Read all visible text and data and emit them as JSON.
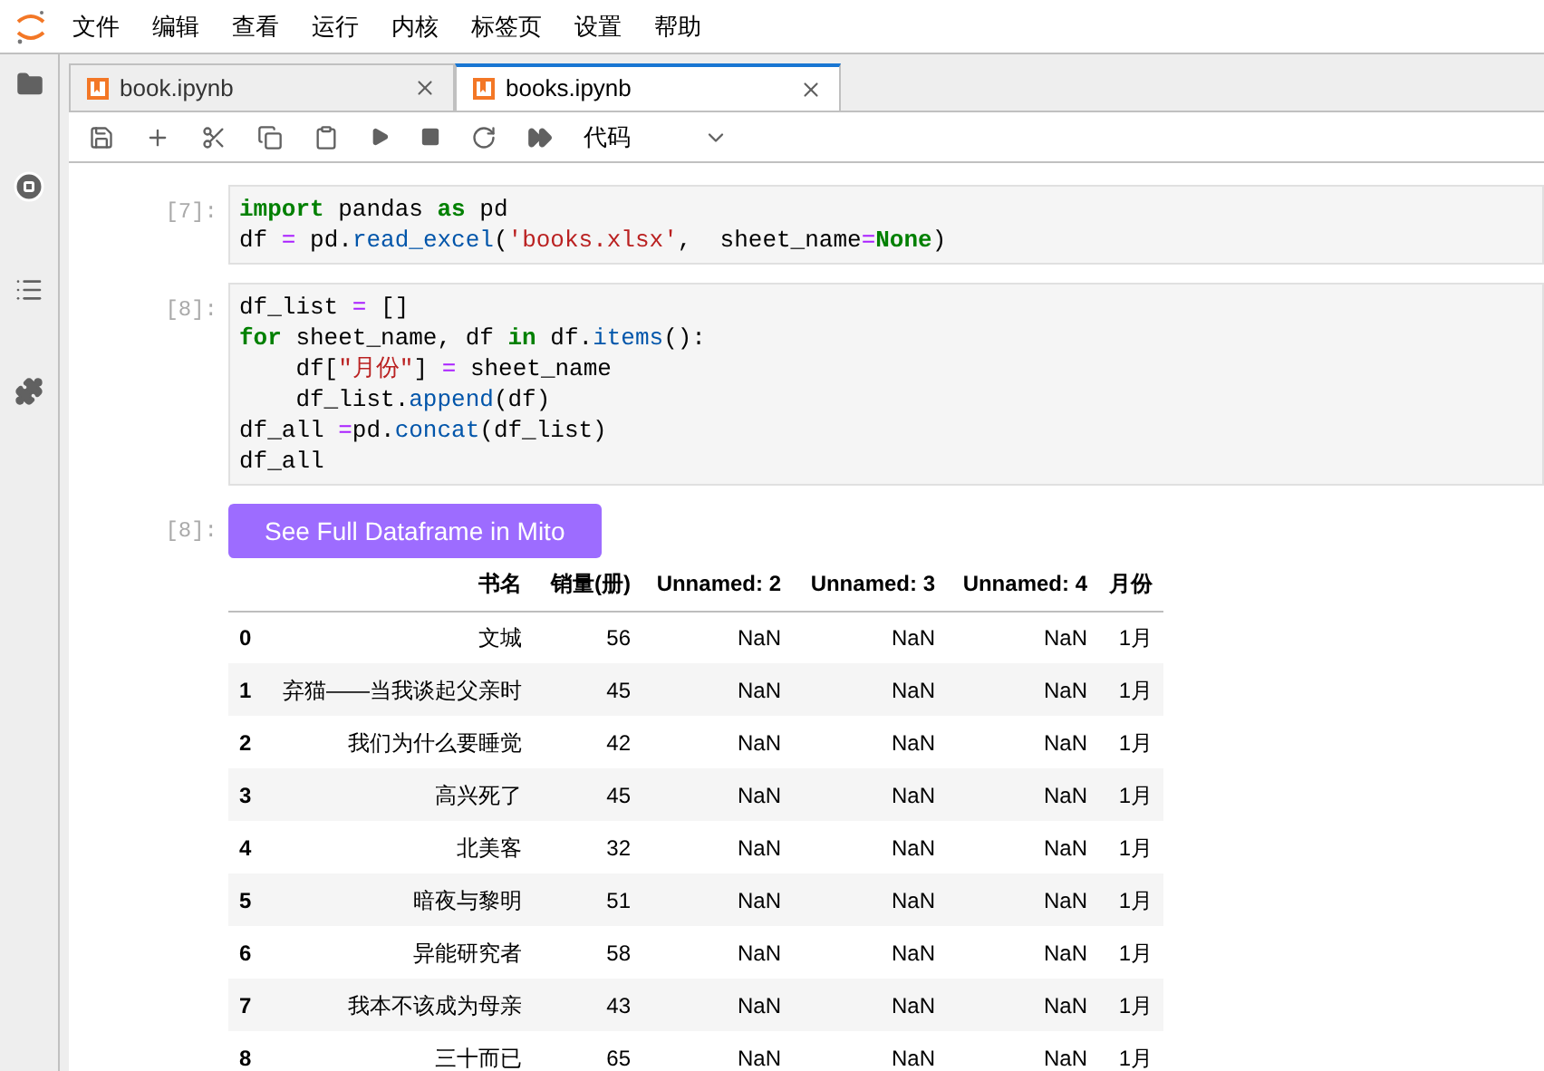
{
  "menu": [
    "文件",
    "编辑",
    "查看",
    "运行",
    "内核",
    "标签页",
    "设置",
    "帮助"
  ],
  "tabs": [
    {
      "label": "book.ipynb",
      "selected": false
    },
    {
      "label": "books.ipynb",
      "selected": true
    }
  ],
  "toolbar": {
    "cell_type": "代码"
  },
  "cells": [
    {
      "prompt": "[7]:",
      "lines": [
        [
          {
            "text": "import",
            "kind": "kw"
          },
          {
            "text": " pandas ",
            "kind": "plain"
          },
          {
            "text": "as",
            "kind": "kw"
          },
          {
            "text": " pd",
            "kind": "plain"
          }
        ],
        [
          {
            "text": "df ",
            "kind": "plain"
          },
          {
            "text": "=",
            "kind": "op"
          },
          {
            "text": " pd.",
            "kind": "plain"
          },
          {
            "text": "read_excel",
            "kind": "fn"
          },
          {
            "text": "(",
            "kind": "plain"
          },
          {
            "text": "'books.xlsx'",
            "kind": "str"
          },
          {
            "text": ",  sheet_name",
            "kind": "plain"
          },
          {
            "text": "=",
            "kind": "op"
          },
          {
            "text": "None",
            "kind": "kw"
          },
          {
            "text": ")",
            "kind": "plain"
          }
        ]
      ]
    },
    {
      "prompt": "[8]:",
      "lines": [
        [
          {
            "text": "df_list ",
            "kind": "plain"
          },
          {
            "text": "=",
            "kind": "op"
          },
          {
            "text": " []",
            "kind": "plain"
          }
        ],
        [
          {
            "text": "for",
            "kind": "kw"
          },
          {
            "text": " sheet_name, df ",
            "kind": "plain"
          },
          {
            "text": "in",
            "kind": "kw"
          },
          {
            "text": " df.",
            "kind": "plain"
          },
          {
            "text": "items",
            "kind": "fn"
          },
          {
            "text": "():",
            "kind": "plain"
          }
        ],
        [
          {
            "text": "    df[",
            "kind": "plain"
          },
          {
            "text": "\"月份\"",
            "kind": "str"
          },
          {
            "text": "] ",
            "kind": "plain"
          },
          {
            "text": "=",
            "kind": "op"
          },
          {
            "text": " sheet_name",
            "kind": "plain"
          }
        ],
        [
          {
            "text": "    df_list.",
            "kind": "plain"
          },
          {
            "text": "append",
            "kind": "fn"
          },
          {
            "text": "(df)",
            "kind": "plain"
          }
        ],
        [
          {
            "text": "df_all ",
            "kind": "plain"
          },
          {
            "text": "=",
            "kind": "op"
          },
          {
            "text": "pd.",
            "kind": "plain"
          },
          {
            "text": "concat",
            "kind": "fn"
          },
          {
            "text": "(df_list)",
            "kind": "plain"
          }
        ],
        [
          {
            "text": "df_all",
            "kind": "plain"
          }
        ]
      ]
    }
  ],
  "output": {
    "prompt": "[8]:",
    "button": "See Full Dataframe in Mito",
    "table": {
      "columns": [
        "书名",
        "销量(册)",
        "Unnamed: 2",
        "Unnamed: 3",
        "Unnamed: 4",
        "月份"
      ],
      "rows": [
        {
          "index": "0",
          "cells": [
            "文城",
            "56",
            "NaN",
            "NaN",
            "NaN",
            "1月"
          ]
        },
        {
          "index": "1",
          "cells": [
            "弃猫——当我谈起父亲时",
            "45",
            "NaN",
            "NaN",
            "NaN",
            "1月"
          ]
        },
        {
          "index": "2",
          "cells": [
            "我们为什么要睡觉",
            "42",
            "NaN",
            "NaN",
            "NaN",
            "1月"
          ]
        },
        {
          "index": "3",
          "cells": [
            "高兴死了",
            "45",
            "NaN",
            "NaN",
            "NaN",
            "1月"
          ]
        },
        {
          "index": "4",
          "cells": [
            "北美客",
            "32",
            "NaN",
            "NaN",
            "NaN",
            "1月"
          ]
        },
        {
          "index": "5",
          "cells": [
            "暗夜与黎明",
            "51",
            "NaN",
            "NaN",
            "NaN",
            "1月"
          ]
        },
        {
          "index": "6",
          "cells": [
            "异能研究者",
            "58",
            "NaN",
            "NaN",
            "NaN",
            "1月"
          ]
        },
        {
          "index": "7",
          "cells": [
            "我本不该成为母亲",
            "43",
            "NaN",
            "NaN",
            "NaN",
            "1月"
          ]
        },
        {
          "index": "8",
          "cells": [
            "三十而已",
            "65",
            "NaN",
            "NaN",
            "NaN",
            "1月"
          ]
        }
      ]
    }
  }
}
